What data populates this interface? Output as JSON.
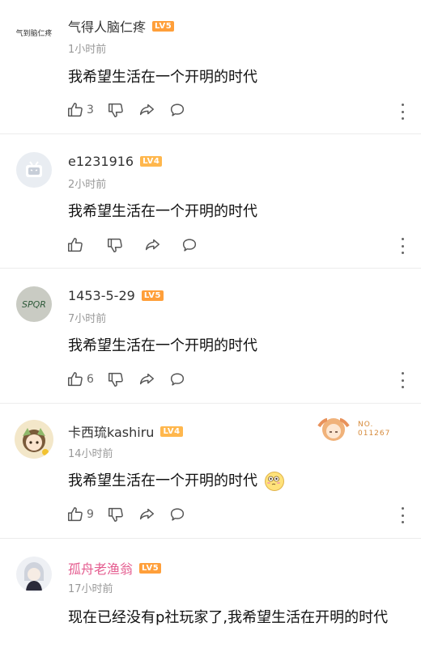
{
  "comments": [
    {
      "username": "气得人脑仁疼",
      "level": "LV5",
      "avatar_text": "气到脑仁疼",
      "time": "1小时前",
      "content": "我希望生活在一个开明的时代",
      "likes": "3"
    },
    {
      "username": "e1231916",
      "level": "LV4",
      "time": "2小时前",
      "content": "我希望生活在一个开明的时代",
      "likes": ""
    },
    {
      "username": "1453-5-29",
      "level": "LV5",
      "avatar_text": "SPQR",
      "time": "7小时前",
      "content": "我希望生活在一个开明的时代",
      "likes": "6"
    },
    {
      "username": "卡西琉kashiru",
      "level": "LV4",
      "time": "14小时前",
      "content": "我希望生活在一个开明的时代",
      "likes": "9",
      "pendant_no": "NO.",
      "pendant_id": "011267"
    },
    {
      "username": "孤舟老渔翁",
      "level": "LV5",
      "time": "17小时前",
      "content": "现在已经没有p社玩家了,我希望生活在开明的时代"
    }
  ],
  "colors": {
    "level_badge": "#ff9f3a",
    "vip_name": "#e45c8f"
  },
  "icons": [
    "thumbs-up-icon",
    "thumbs-down-icon",
    "share-icon",
    "reply-icon",
    "more-icon"
  ]
}
